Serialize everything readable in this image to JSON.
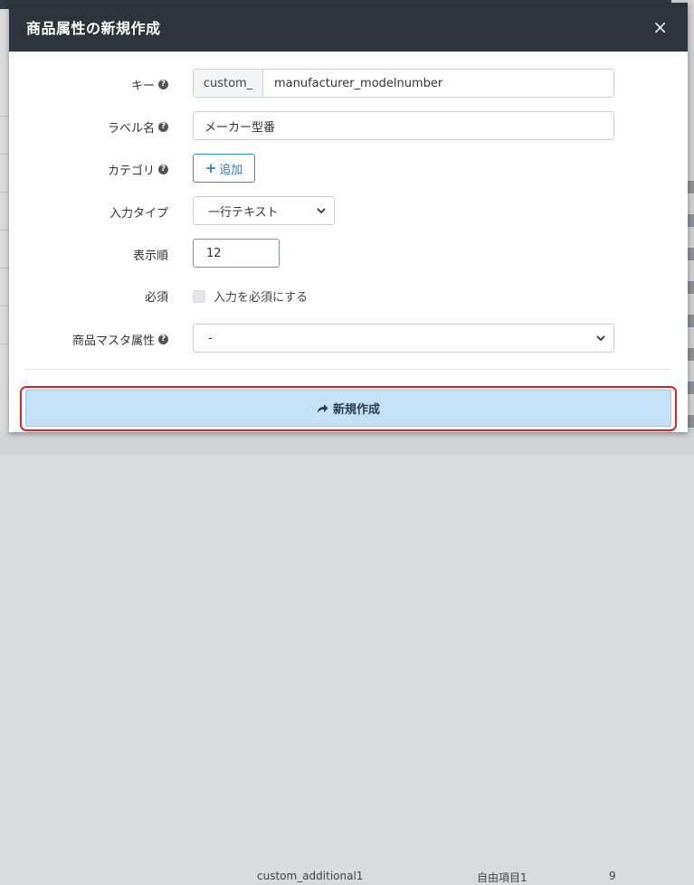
{
  "modal": {
    "title": "商品属性の新規作成",
    "close": "×"
  },
  "form": {
    "key": {
      "label": "キー",
      "prefix": "custom_",
      "value": "manufacturer_modelnumber"
    },
    "label_name": {
      "label": "ラベル名",
      "value": "メーカー型番"
    },
    "category": {
      "label": "カテゴリ",
      "add_button": "追加"
    },
    "input_type": {
      "label": "入力タイプ",
      "selected": "一行テキスト"
    },
    "display_order": {
      "label": "表示順",
      "value": "12"
    },
    "required": {
      "label": "必須",
      "checkbox_label": "入力を必須にする",
      "checked": false
    },
    "master_attribute": {
      "label": "商品マスタ属性",
      "selected": "-"
    },
    "submit_label": "新規作成"
  },
  "background": {
    "bottom_left_text": "custom_additional1",
    "bottom_mid_text": "自由項目1",
    "bottom_right_text": "9"
  },
  "colors": {
    "header_bg": "#2d343b",
    "primary_blue": "#2b7fc0",
    "submit_bg": "#c4e1f6",
    "highlight_red": "#e02424"
  },
  "icons": {
    "help": "question-circle-icon",
    "add": "plus-icon",
    "select_arrow": "chevron-down-icon",
    "submit": "share-arrow-icon"
  }
}
